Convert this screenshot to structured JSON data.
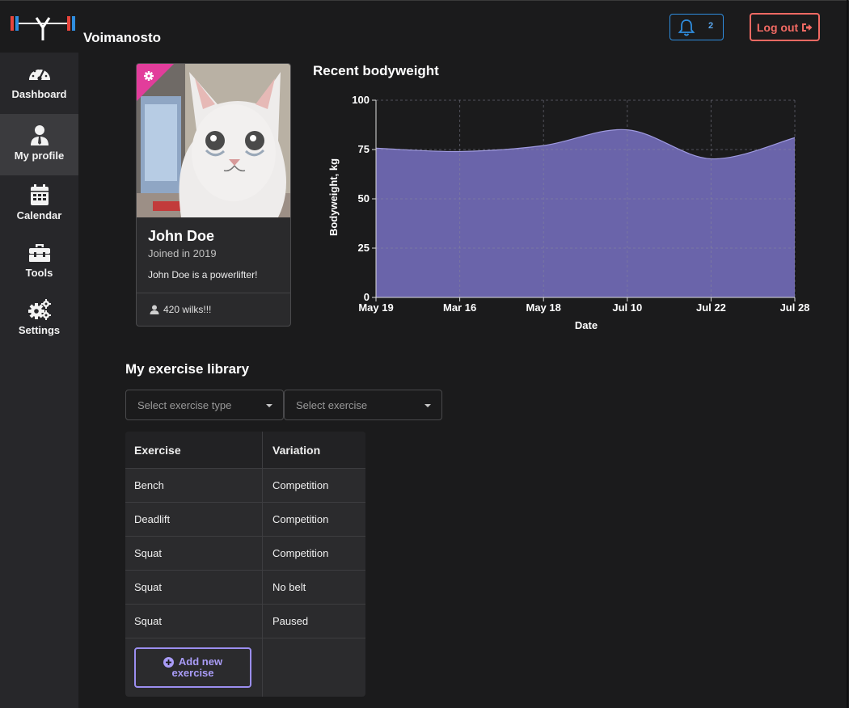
{
  "app": {
    "name": "Voimanosto"
  },
  "header": {
    "notification_count": "2",
    "logout_label": "Log out"
  },
  "sidebar": {
    "items": [
      {
        "label": "Dashboard",
        "icon": "dashboard-gauge-icon"
      },
      {
        "label": "My profile",
        "icon": "user-tie-icon"
      },
      {
        "label": "Calendar",
        "icon": "calendar-icon"
      },
      {
        "label": "Tools",
        "icon": "toolbox-icon"
      },
      {
        "label": "Settings",
        "icon": "cogs-icon"
      }
    ],
    "active": "My profile"
  },
  "profile": {
    "name": "John Doe",
    "joined": "Joined in 2019",
    "bio": "John Doe is a powerlifter!",
    "wilks": "420 wilks!!!"
  },
  "chart_title": "Recent bodyweight",
  "chart_data": {
    "type": "area",
    "x": [
      "May 19",
      "Mar 16",
      "May 18",
      "Jul 10",
      "Jul 22",
      "Jul 28"
    ],
    "values": [
      75.7,
      74.0,
      77.0,
      85.0,
      70.3,
      81.0
    ],
    "xlabel": "Date",
    "ylabel": "Bodyweight, kg",
    "ylim": [
      0,
      100
    ],
    "yticks": [
      "0",
      "25",
      "50",
      "75",
      "100"
    ],
    "grid": true,
    "fill_color": "#6a64aa",
    "line_color": "#9f9ae0"
  },
  "library": {
    "title": "My exercise library",
    "type_placeholder": "Select exercise type",
    "exercise_placeholder": "Select exercise",
    "columns": [
      "Exercise",
      "Variation"
    ],
    "rows": [
      [
        "Bench",
        "Competition"
      ],
      [
        "Deadlift",
        "Competition"
      ],
      [
        "Squat",
        "Competition"
      ],
      [
        "Squat",
        "No belt"
      ],
      [
        "Squat",
        "Paused"
      ]
    ],
    "add_label_line1": "Add new",
    "add_label_line2": "exercise"
  },
  "colors": {
    "background": "#1b1b1c",
    "sidebar": "#27272a",
    "notif_border": "#2f8dde",
    "logout": "#f26a63",
    "accent_purple": "#9b8ef0",
    "ribbon_pink": "#e23d9b"
  }
}
